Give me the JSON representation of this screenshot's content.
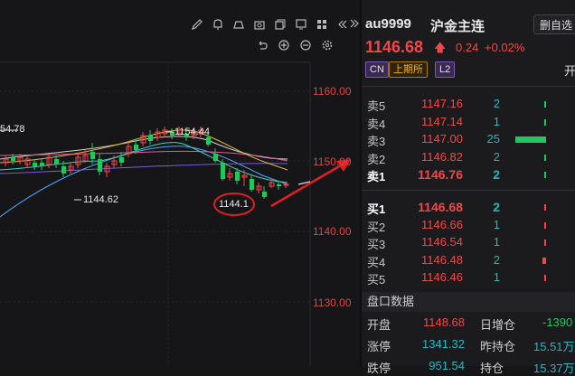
{
  "toolbar": {
    "top_icons": [
      "pencil-icon",
      "bell-icon",
      "cloud-upload-icon",
      "camera-icon",
      "copy-icon",
      "monitor-icon",
      "grid-icon",
      "double-left-icon",
      "double-right-icon"
    ],
    "second_icons": [
      "undo-icon",
      "zoom-in-icon",
      "zoom-out-icon",
      "settings-icon"
    ]
  },
  "chart": {
    "price_axis": [
      "1160.00",
      "1150.00",
      "1140.00",
      "1130.00"
    ],
    "annotations": {
      "left_value": "54.78",
      "high": "1154.44",
      "low": "1144.62",
      "circled": "1144.1"
    }
  },
  "quote": {
    "symbol": "au9999",
    "name": "沪金主连",
    "watch_button": "删自选",
    "price": "1146.68",
    "change": "0.24",
    "change_pct": "+0.02%",
    "tags": [
      "CN",
      "上期所",
      "L2"
    ],
    "trailing": "开",
    "asks": [
      {
        "label": "卖5",
        "price": "1147.16",
        "qty": "2"
      },
      {
        "label": "卖4",
        "price": "1147.14",
        "qty": "1"
      },
      {
        "label": "卖3",
        "price": "1147.00",
        "qty": "25"
      },
      {
        "label": "卖2",
        "price": "1146.82",
        "qty": "2"
      },
      {
        "label": "卖1",
        "price": "1146.76",
        "qty": "2"
      }
    ],
    "bids": [
      {
        "label": "买1",
        "price": "1146.68",
        "qty": "2"
      },
      {
        "label": "买2",
        "price": "1146.66",
        "qty": "1"
      },
      {
        "label": "买3",
        "price": "1146.54",
        "qty": "1"
      },
      {
        "label": "买4",
        "price": "1146.48",
        "qty": "2"
      },
      {
        "label": "买5",
        "price": "1146.46",
        "qty": "1"
      }
    ],
    "panel_title": "盘口数据",
    "stats": [
      {
        "k": "开盘",
        "v": "1148.68",
        "k2": "日增仓",
        "v2": "-1390"
      },
      {
        "k": "涨停",
        "v": "1341.32",
        "k2": "昨持仓",
        "v2": "15.51万"
      },
      {
        "k": "跌停",
        "v": "951.54",
        "k2": "持仓",
        "v2": "15.37万"
      }
    ],
    "colors": {
      "up": "#f04848",
      "down": "#22c55e",
      "qty": "#22b8c0",
      "exchange": "#ffb000"
    }
  }
}
